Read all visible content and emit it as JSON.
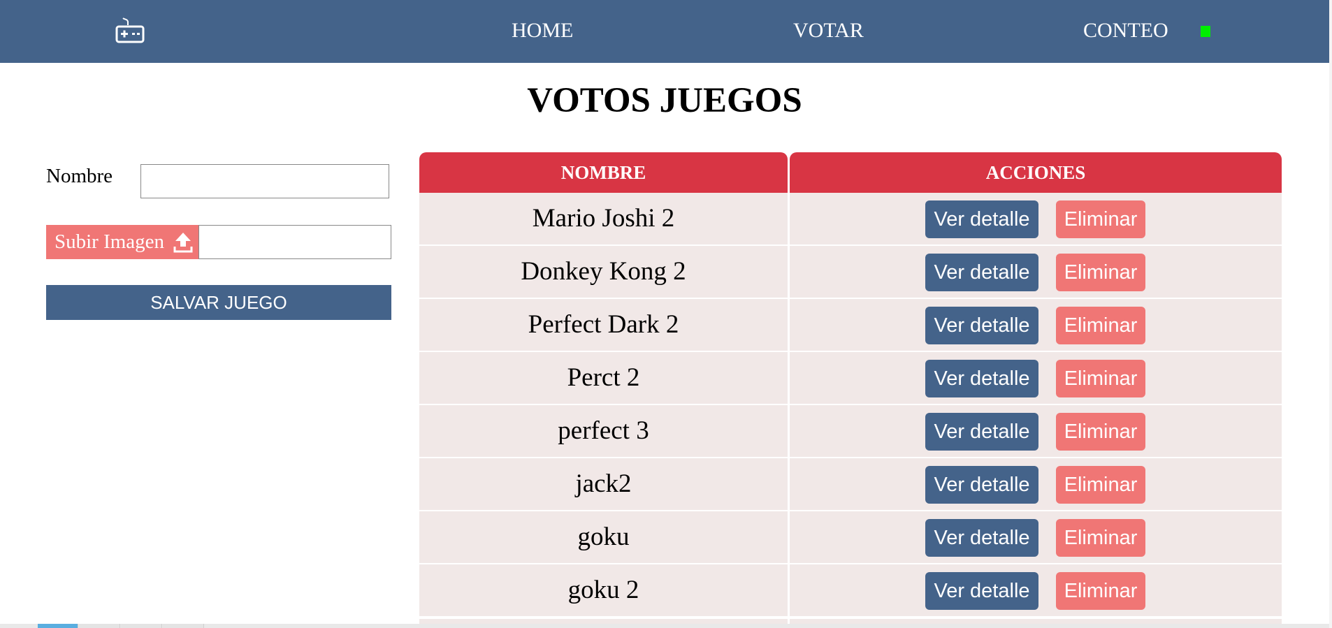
{
  "navbar": {
    "logo_icon": "gamepad-icon",
    "links": {
      "home": "HOME",
      "votar": "VOTAR",
      "conteo": "CONTEO"
    },
    "status_color": "#00ee00"
  },
  "page": {
    "title": "VOTOS JUEGOS"
  },
  "form": {
    "name_label": "Nombre",
    "name_value": "",
    "upload_label": "Subir Imagen",
    "upload_icon": "upload-icon",
    "upload_value": "",
    "save_label": "SALVAR JUEGO"
  },
  "table": {
    "headers": {
      "nombre": "NOMBRE",
      "acciones": "ACCIONES"
    },
    "action_labels": {
      "detail": "Ver detalle",
      "delete": "Eliminar"
    },
    "rows": [
      {
        "name": "Mario Joshi 2"
      },
      {
        "name": "Donkey Kong 2"
      },
      {
        "name": "Perfect Dark 2"
      },
      {
        "name": "Perct 2"
      },
      {
        "name": "perfect 3"
      },
      {
        "name": "jack2"
      },
      {
        "name": "goku"
      },
      {
        "name": "goku 2"
      }
    ]
  },
  "colors": {
    "primary": "#44638a",
    "danger": "#d83544",
    "danger_light": "#f07675",
    "row_bg": "#f1e8e7"
  }
}
